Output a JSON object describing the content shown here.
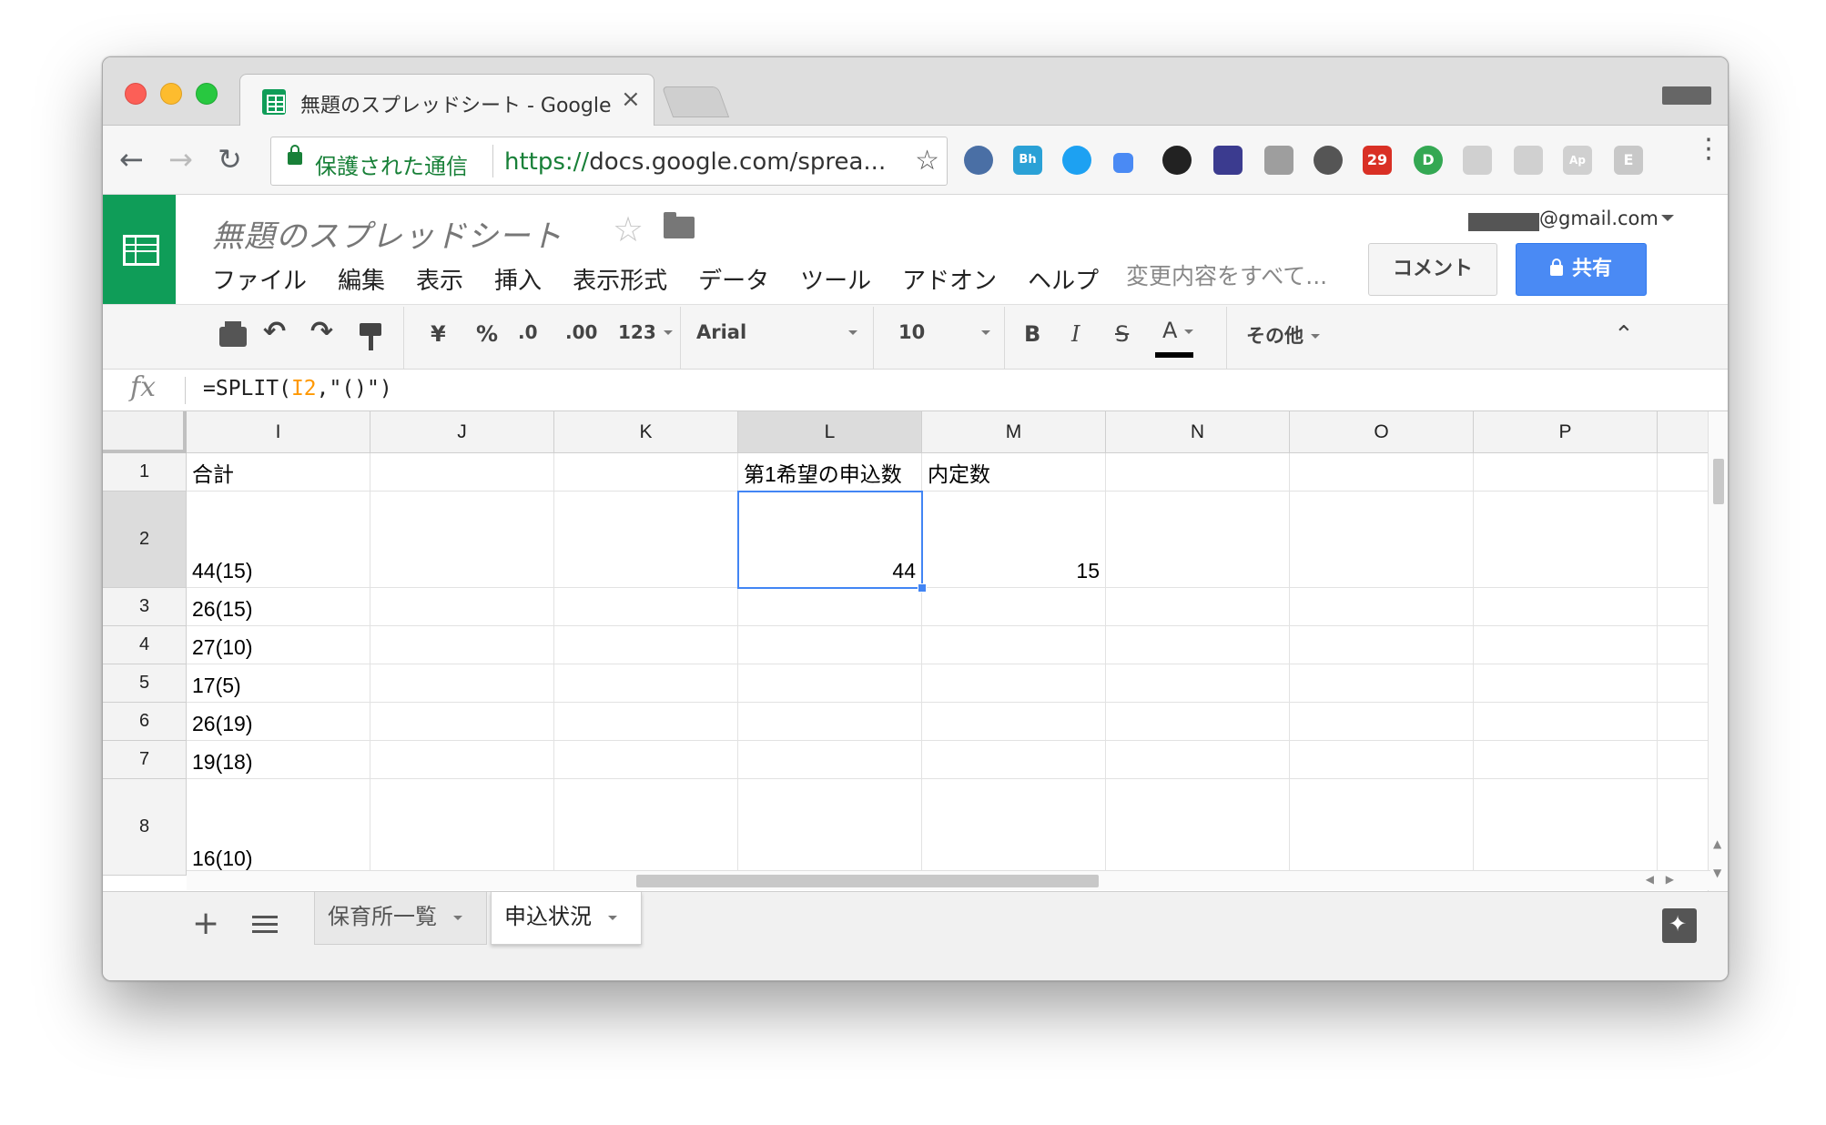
{
  "browser": {
    "tab_title": "無題のスプレッドシート - Google",
    "tab_close": "×",
    "back": "←",
    "forward": "→",
    "reload": "↻",
    "secure_label": "保護された通信",
    "url_protocol": "https://",
    "url_rest": "docs.google.com/sprea...",
    "bookmark_star": "☆",
    "ext_calendar_badge": "29",
    "ext_bh": "Bh",
    "ext_ap": "Ap",
    "ext_e": "E",
    "ext_id": "D",
    "menu_dots": "⋮"
  },
  "app": {
    "doc_title": "無題のスプレッドシート",
    "doc_star": "☆",
    "menus": [
      "ファイル",
      "編集",
      "表示",
      "挿入",
      "表示形式",
      "データ",
      "ツール",
      "アドオン",
      "ヘルプ"
    ],
    "save_status": "変更内容をすべて...",
    "account_email": "@gmail.com",
    "comment_button": "コメント",
    "share_button": "共有"
  },
  "toolbar": {
    "undo": "↶",
    "redo": "↷",
    "currency": "¥",
    "percent": "%",
    "decimal_decrease": ".0",
    "decimal_increase": ".00",
    "number_format": "123",
    "font": "Arial",
    "font_size": "10",
    "bold": "B",
    "italic": "I",
    "strikethrough": "S",
    "text_color": "A",
    "more": "その他",
    "collapse": "⌃"
  },
  "formula_bar": {
    "fx": "fx",
    "prefix": "=SPLIT(",
    "ref": "I2",
    "suffix": ",\"()\")"
  },
  "grid": {
    "columns": [
      "I",
      "J",
      "K",
      "L",
      "M",
      "N",
      "O",
      "P"
    ],
    "selected_column": "L",
    "selected_row": "2",
    "rows": [
      {
        "num": "1",
        "I": "合計",
        "L": "第1希望の申込数",
        "M": "内定数"
      },
      {
        "num": "2",
        "I": "44(15)",
        "L": "44",
        "M": "15"
      },
      {
        "num": "3",
        "I": "26(15)"
      },
      {
        "num": "4",
        "I": "27(10)"
      },
      {
        "num": "5",
        "I": "17(5)"
      },
      {
        "num": "6",
        "I": "26(19)"
      },
      {
        "num": "7",
        "I": "19(18)"
      },
      {
        "num": "8",
        "I": "16(10)"
      }
    ]
  },
  "sheets": {
    "add": "+",
    "tabs": [
      "保育所一覧",
      "申込状況"
    ],
    "active_tab": "申込状況"
  },
  "colors": {
    "sheets_green": "#0f9d58",
    "share_blue": "#4a8af4",
    "selection_blue": "#4285f4",
    "formula_ref": "#ff9800"
  }
}
